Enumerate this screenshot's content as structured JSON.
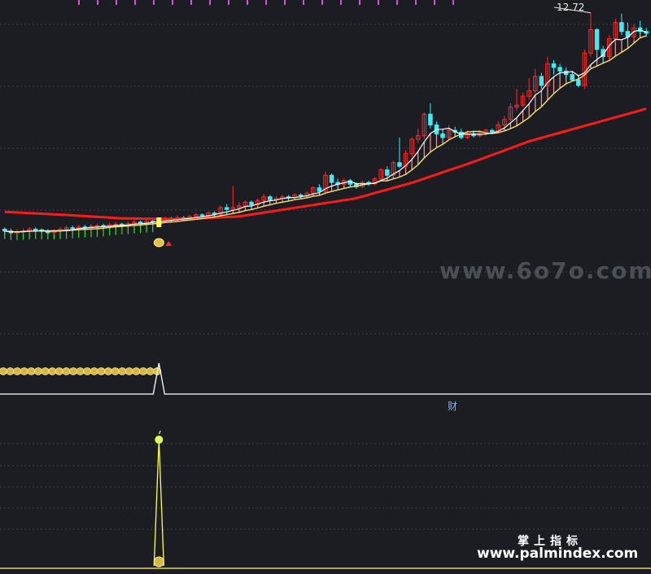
{
  "labels": {
    "price_high": "12.72",
    "indicator": "财",
    "watermark_center": "www.6o7o.com",
    "watermark_cn": "掌上指标",
    "watermark_url": "www.palmindex.com"
  },
  "colors": {
    "background": "#1b1d22",
    "grid": "#3a3f4a",
    "up": "#ff2a2a",
    "down": "#43e8f2",
    "ma_long": "#ff1a1a",
    "ma_mid": "#ffe070",
    "ma_short": "#ffffff",
    "ma_green": "#33dd33",
    "magenta": "#d84fd8",
    "signal": "#ffff55"
  },
  "chart_data": [
    {
      "type": "candlestick",
      "y_min": 5.6,
      "y_max": 12.85,
      "marked_high": 12.72,
      "candles": [
        [
          6.7,
          6.65,
          6.75,
          6.55
        ],
        [
          6.65,
          6.6,
          6.72,
          6.55
        ],
        [
          6.6,
          6.62,
          6.7,
          6.55
        ],
        [
          6.62,
          6.65,
          6.72,
          6.58
        ],
        [
          6.65,
          6.7,
          6.75,
          6.6
        ],
        [
          6.7,
          6.68,
          6.75,
          6.62
        ],
        [
          6.68,
          6.64,
          6.72,
          6.6
        ],
        [
          6.64,
          6.6,
          6.7,
          6.56
        ],
        [
          6.6,
          6.66,
          6.7,
          6.55
        ],
        [
          6.66,
          6.7,
          6.75,
          6.62
        ],
        [
          6.7,
          6.74,
          6.8,
          6.66
        ],
        [
          6.74,
          6.72,
          6.8,
          6.68
        ],
        [
          6.72,
          6.76,
          6.82,
          6.68
        ],
        [
          6.76,
          6.73,
          6.82,
          6.7
        ],
        [
          6.73,
          6.78,
          6.84,
          6.7
        ],
        [
          6.78,
          6.8,
          6.86,
          6.74
        ],
        [
          6.8,
          6.77,
          6.85,
          6.73
        ],
        [
          6.77,
          6.82,
          6.88,
          6.74
        ],
        [
          6.82,
          6.84,
          6.9,
          6.78
        ],
        [
          6.84,
          6.8,
          6.88,
          6.76
        ],
        [
          6.8,
          6.85,
          6.92,
          6.78
        ],
        [
          6.85,
          6.9,
          6.95,
          6.8
        ],
        [
          6.9,
          6.86,
          6.94,
          6.82
        ],
        [
          6.86,
          6.92,
          6.98,
          6.84
        ],
        [
          6.92,
          6.9,
          6.96,
          6.86
        ],
        [
          6.9,
          6.95,
          7.0,
          6.86
        ],
        [
          6.95,
          7.0,
          7.05,
          6.9
        ],
        [
          7.0,
          6.96,
          7.04,
          6.92
        ],
        [
          6.96,
          7.02,
          7.08,
          6.94
        ],
        [
          7.02,
          6.98,
          7.06,
          6.94
        ],
        [
          6.98,
          7.05,
          7.1,
          6.95
        ],
        [
          7.05,
          7.1,
          7.15,
          7.0
        ],
        [
          7.1,
          7.08,
          7.14,
          7.04
        ],
        [
          7.08,
          7.15,
          7.2,
          7.05
        ],
        [
          7.15,
          7.12,
          7.2,
          7.08
        ],
        [
          7.12,
          7.3,
          7.35,
          7.1
        ],
        [
          7.3,
          7.25,
          7.4,
          7.2
        ],
        [
          7.25,
          7.3,
          7.9,
          7.2
        ],
        [
          7.3,
          7.35,
          7.45,
          7.25
        ],
        [
          7.35,
          7.45,
          7.5,
          7.3
        ],
        [
          7.45,
          7.38,
          7.5,
          7.3
        ],
        [
          7.38,
          7.5,
          7.55,
          7.35
        ],
        [
          7.5,
          7.6,
          7.68,
          7.45
        ],
        [
          7.6,
          7.52,
          7.65,
          7.48
        ],
        [
          7.52,
          7.55,
          7.62,
          7.5
        ],
        [
          7.55,
          7.6,
          7.66,
          7.5
        ],
        [
          7.6,
          7.58,
          7.65,
          7.52
        ],
        [
          7.58,
          7.65,
          7.7,
          7.55
        ],
        [
          7.65,
          7.62,
          7.7,
          7.58
        ],
        [
          7.62,
          7.7,
          7.75,
          7.6
        ],
        [
          7.7,
          7.85,
          7.9,
          7.65
        ],
        [
          7.85,
          7.75,
          7.95,
          7.7
        ],
        [
          7.75,
          8.2,
          8.3,
          7.7
        ],
        [
          8.2,
          8.0,
          8.25,
          7.9
        ],
        [
          8.0,
          7.95,
          8.1,
          7.85
        ],
        [
          7.95,
          8.05,
          8.12,
          7.9
        ],
        [
          8.05,
          7.95,
          8.1,
          7.88
        ],
        [
          7.95,
          7.88,
          8.0,
          7.82
        ],
        [
          7.88,
          8.0,
          8.05,
          7.85
        ],
        [
          8.0,
          7.96,
          8.05,
          7.9
        ],
        [
          7.96,
          8.1,
          8.15,
          7.92
        ],
        [
          8.1,
          8.35,
          8.4,
          8.05
        ],
        [
          8.35,
          8.2,
          8.45,
          8.15
        ],
        [
          8.2,
          8.55,
          8.6,
          8.15
        ],
        [
          8.55,
          8.45,
          9.25,
          8.4
        ],
        [
          8.45,
          8.8,
          8.9,
          8.4
        ],
        [
          8.8,
          9.2,
          9.25,
          8.7
        ],
        [
          9.2,
          9.3,
          9.5,
          9.1
        ],
        [
          9.3,
          9.9,
          9.95,
          9.2
        ],
        [
          9.9,
          9.6,
          10.2,
          9.5
        ],
        [
          9.6,
          9.35,
          9.7,
          9.3
        ],
        [
          9.35,
          9.25,
          9.45,
          9.2
        ],
        [
          9.25,
          9.45,
          9.6,
          9.2
        ],
        [
          9.45,
          9.4,
          9.55,
          9.3
        ],
        [
          9.4,
          9.25,
          9.5,
          9.2
        ],
        [
          9.25,
          9.35,
          9.45,
          9.2
        ],
        [
          9.35,
          9.3,
          9.45,
          9.25
        ],
        [
          9.3,
          9.38,
          9.45,
          9.25
        ],
        [
          9.38,
          9.45,
          9.5,
          9.3
        ],
        [
          9.45,
          9.4,
          9.5,
          9.35
        ],
        [
          9.4,
          9.6,
          9.7,
          9.35
        ],
        [
          9.6,
          9.75,
          9.85,
          9.5
        ],
        [
          9.75,
          10.1,
          10.2,
          9.7
        ],
        [
          10.1,
          10.15,
          10.6,
          10.0
        ],
        [
          10.15,
          10.4,
          10.5,
          10.1
        ],
        [
          10.4,
          10.55,
          10.9,
          10.3
        ],
        [
          10.55,
          10.95,
          11.15,
          10.45
        ],
        [
          10.95,
          10.7,
          11.05,
          10.6
        ],
        [
          10.7,
          11.3,
          11.5,
          10.65
        ],
        [
          11.3,
          11.2,
          11.4,
          11.0
        ],
        [
          11.2,
          11.1,
          11.3,
          10.95
        ],
        [
          11.1,
          11.0,
          11.2,
          10.9
        ],
        [
          11.0,
          10.85,
          11.1,
          10.8
        ],
        [
          10.85,
          10.7,
          11.0,
          10.65
        ],
        [
          10.7,
          11.6,
          11.7,
          10.6
        ],
        [
          11.6,
          12.25,
          12.72,
          11.5
        ],
        [
          12.25,
          11.7,
          12.3,
          11.4
        ],
        [
          11.7,
          11.5,
          11.8,
          11.3
        ],
        [
          11.5,
          12.0,
          12.1,
          11.4
        ],
        [
          12.0,
          12.45,
          12.55,
          11.9
        ],
        [
          12.45,
          12.2,
          12.7,
          12.1
        ],
        [
          12.2,
          12.05,
          12.45,
          11.9
        ],
        [
          12.05,
          12.3,
          12.4,
          11.95
        ],
        [
          12.3,
          12.2,
          12.5,
          12.1
        ],
        [
          12.2,
          12.15,
          12.3,
          12.05
        ]
      ],
      "ma_long_levels": [
        7.18,
        7.1,
        7.0,
        6.98,
        7.05,
        7.3,
        7.55,
        8.0,
        8.55,
        9.15,
        9.6,
        10.05
      ],
      "signal_marker_index": 25
    },
    {
      "type": "line",
      "name": "indicator",
      "spike_index": 25
    }
  ]
}
